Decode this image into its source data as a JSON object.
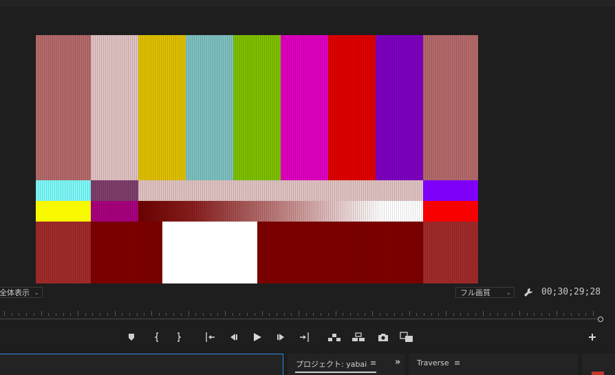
{
  "monitor": {
    "fit_label": "全体表示",
    "quality_label": "フル画質",
    "timecode": "00;30;29;28"
  },
  "colors": {
    "background": "#1d1d1d",
    "panel": "#232323",
    "focus_border": "#2d8ceb",
    "text": "#c8c8c8",
    "red_panel_marker": "#c0392b"
  },
  "transport": {
    "buttons": [
      {
        "name": "add-marker-button",
        "icon": "marker-icon"
      },
      {
        "name": "mark-in-button",
        "icon": "mark-in-icon"
      },
      {
        "name": "mark-out-button",
        "icon": "mark-out-icon"
      },
      {
        "name": "go-to-in-button",
        "icon": "go-to-in-icon"
      },
      {
        "name": "step-back-button",
        "icon": "step-back-icon"
      },
      {
        "name": "play-button",
        "icon": "play-icon"
      },
      {
        "name": "step-forward-button",
        "icon": "step-forward-icon"
      },
      {
        "name": "go-to-out-button",
        "icon": "go-to-out-icon"
      },
      {
        "name": "lift-button",
        "icon": "lift-icon"
      },
      {
        "name": "extract-button",
        "icon": "extract-icon"
      },
      {
        "name": "export-frame-button",
        "icon": "camera-icon"
      },
      {
        "name": "comparison-view-button",
        "icon": "compare-icon"
      },
      {
        "name": "button-editor-button",
        "icon": "plus-icon"
      }
    ]
  },
  "panels": {
    "project_tab": "プロジェクト: yabai",
    "overflow": "»",
    "traverse_tab": "Traverse",
    "menu_icon": "≡"
  }
}
